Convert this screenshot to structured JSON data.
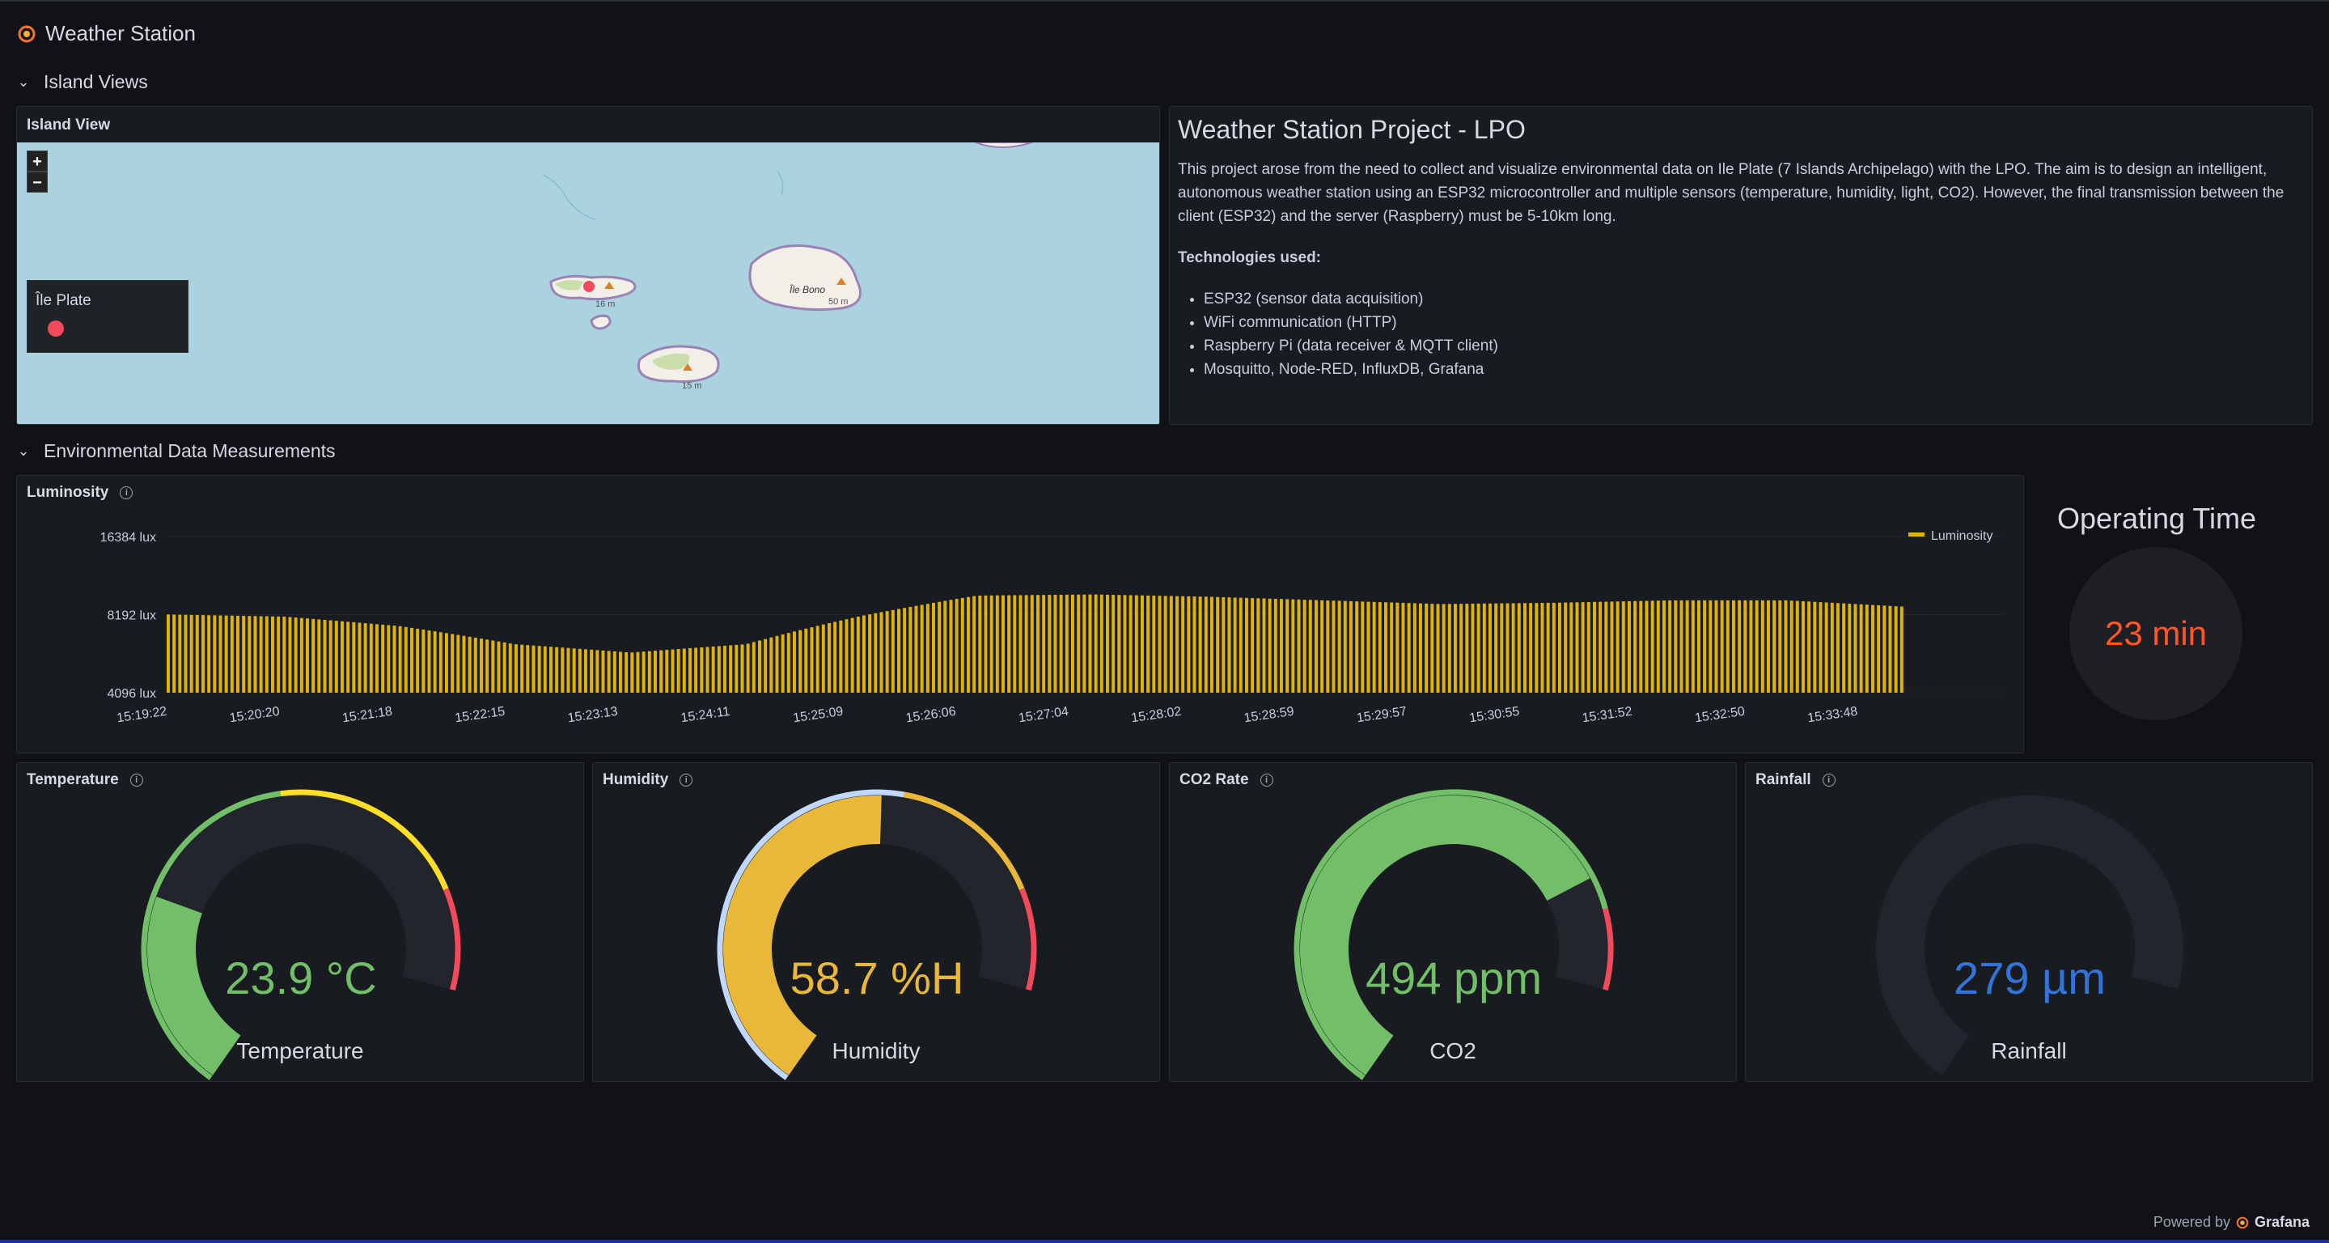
{
  "header": {
    "title": "Weather Station",
    "logo": "grafana-icon"
  },
  "rows": [
    {
      "label": "Island Views"
    },
    {
      "label": "Environmental Data Measurements"
    }
  ],
  "map_panel": {
    "title": "Island View",
    "zoom_in": "+",
    "zoom_out": "−",
    "legend_label": "Île Plate",
    "marker_color": "#f2495c",
    "place_labels": [
      "Île Bono",
      "16 m",
      "50 m",
      "15 m"
    ]
  },
  "text_panel": {
    "heading": "Weather Station Project - LPO",
    "paragraph": "This project arose from the need to collect and visualize environmental data on Ile Plate (7 Islands Archipelago) with the LPO. The aim is to design an intelligent, autonomous weather station using an ESP32 microcontroller and multiple sensors (temperature, humidity, light, CO2). However, the final transmission between the client (ESP32) and the server (Raspberry) must be 5-10km long.",
    "tech_label": "Technologies used:",
    "tech_list": [
      "ESP32 (sensor data acquisition)",
      "WiFi communication (HTTP)",
      "Raspberry Pi (data receiver & MQTT client)",
      "Mosquitto, Node-RED, InfluxDB, Grafana"
    ]
  },
  "luminosity_panel": {
    "title": "Luminosity",
    "chart_data": {
      "type": "bar",
      "title": "Luminosity",
      "xlabel": "",
      "ylabel": "",
      "y_scale": "log2",
      "y_ticks": [
        "16384 lux",
        "8192 lux",
        "4096 lux"
      ],
      "ylim": [
        4096,
        16384
      ],
      "x_ticks": [
        "15:19:22",
        "15:20:20",
        "15:21:18",
        "15:22:15",
        "15:23:13",
        "15:24:11",
        "15:25:09",
        "15:26:06",
        "15:27:04",
        "15:28:02",
        "15:28:59",
        "15:29:57",
        "15:30:55",
        "15:31:52",
        "15:32:50",
        "15:33:48"
      ],
      "series": [
        {
          "name": "Luminosity",
          "color": "#e0b400",
          "x": [
            "15:19:22",
            "15:20:20",
            "15:21:18",
            "15:22:15",
            "15:23:13",
            "15:24:11",
            "15:25:09",
            "15:26:06",
            "15:27:04",
            "15:28:02",
            "15:28:59",
            "15:29:57",
            "15:30:55",
            "15:31:52",
            "15:32:50",
            "15:33:48"
          ],
          "values": [
            8200,
            8050,
            7400,
            6300,
            5850,
            6300,
            8100,
            9700,
            9800,
            9600,
            9300,
            9000,
            9100,
            9300,
            9300,
            8800
          ]
        }
      ],
      "legend": "top-right",
      "grid": true
    }
  },
  "operating_time": {
    "title": "Operating Time",
    "value": "23 min",
    "color": "#ff5722"
  },
  "gauges": [
    {
      "title": "Temperature",
      "value": "23.9 °C",
      "label": "Temperature",
      "fraction": 0.3,
      "color": "#73bf69",
      "thresholds": [
        {
          "to": 0.55,
          "color": "#73bf69"
        },
        {
          "to": 0.85,
          "color": "#fade2a"
        },
        {
          "to": 1,
          "color": "#f2495c"
        }
      ]
    },
    {
      "title": "Humidity",
      "value": "58.7 %H",
      "label": "Humidity",
      "fraction": 0.587,
      "color": "#eab839",
      "thresholds": [
        {
          "to": 0.62,
          "color": "#c0d8ff"
        },
        {
          "to": 0.85,
          "color": "#eab839"
        },
        {
          "to": 1,
          "color": "#f2495c"
        }
      ]
    },
    {
      "title": "CO2 Rate",
      "value": "494 ppm",
      "label": "CO2",
      "fraction": 0.83,
      "color": "#73bf69",
      "thresholds": [
        {
          "to": 0.88,
          "color": "#73bf69"
        },
        {
          "to": 1,
          "color": "#f2495c"
        }
      ]
    },
    {
      "title": "Rainfall",
      "value": "279 µm",
      "label": "Rainfall",
      "fraction": 0,
      "color": "#3274d9",
      "thresholds": []
    }
  ],
  "footer": {
    "powered": "Powered by",
    "brand": "Grafana"
  }
}
